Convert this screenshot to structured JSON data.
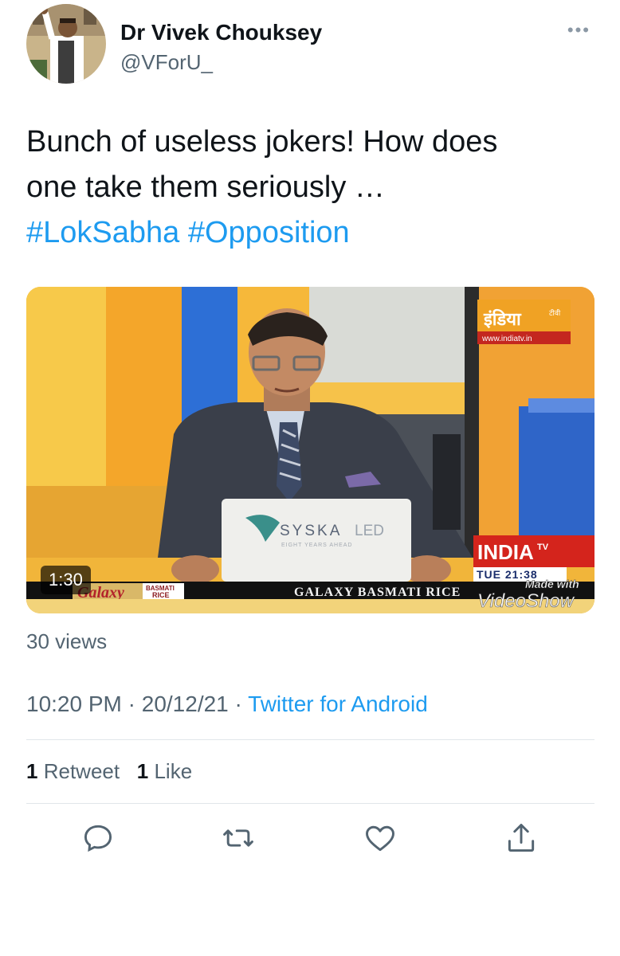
{
  "author": {
    "name": "Dr Vivek Chouksey",
    "handle": "@VForU_",
    "more_icon": "more-dots-icon"
  },
  "tweet": {
    "text_line1": "Bunch of useless jokers! How does",
    "text_line2": "one take them seriously …",
    "hashtags": [
      "#LokSabha",
      "#Opposition"
    ]
  },
  "video": {
    "duration": "1:30",
    "channel_logo_hindi": "इंडिया",
    "channel_logo_small": "टीवी",
    "channel_url": "www.indiatv.in",
    "laptop_brand": "SYSKA",
    "laptop_brand_suffix": "LED",
    "laptop_tagline": "EIGHT YEARS AHEAD",
    "channel_name": "INDIA",
    "channel_tv": "TV",
    "clock": "TUE 21:38",
    "ticker_brand": "Galaxy",
    "ticker_badge_top": "BASMATI",
    "ticker_badge_bottom": "RICE",
    "ticker_text": "GALAXY BASMATI RICE",
    "watermark_top": "Made with",
    "watermark_bottom": "VideoShow"
  },
  "views": "30 views",
  "meta": {
    "time": "10:20 PM",
    "date": "20/12/21",
    "separator": "·",
    "source": "Twitter for Android"
  },
  "engagement": {
    "retweets_count": "1",
    "retweets_label": "Retweet",
    "likes_count": "1",
    "likes_label": "Like"
  },
  "actions": [
    "reply-icon",
    "retweet-icon",
    "like-icon",
    "share-icon"
  ],
  "colors": {
    "link": "#1d9bf0",
    "secondary": "#536471",
    "primary_text": "#0f1419",
    "divider": "#e1e6ea"
  }
}
